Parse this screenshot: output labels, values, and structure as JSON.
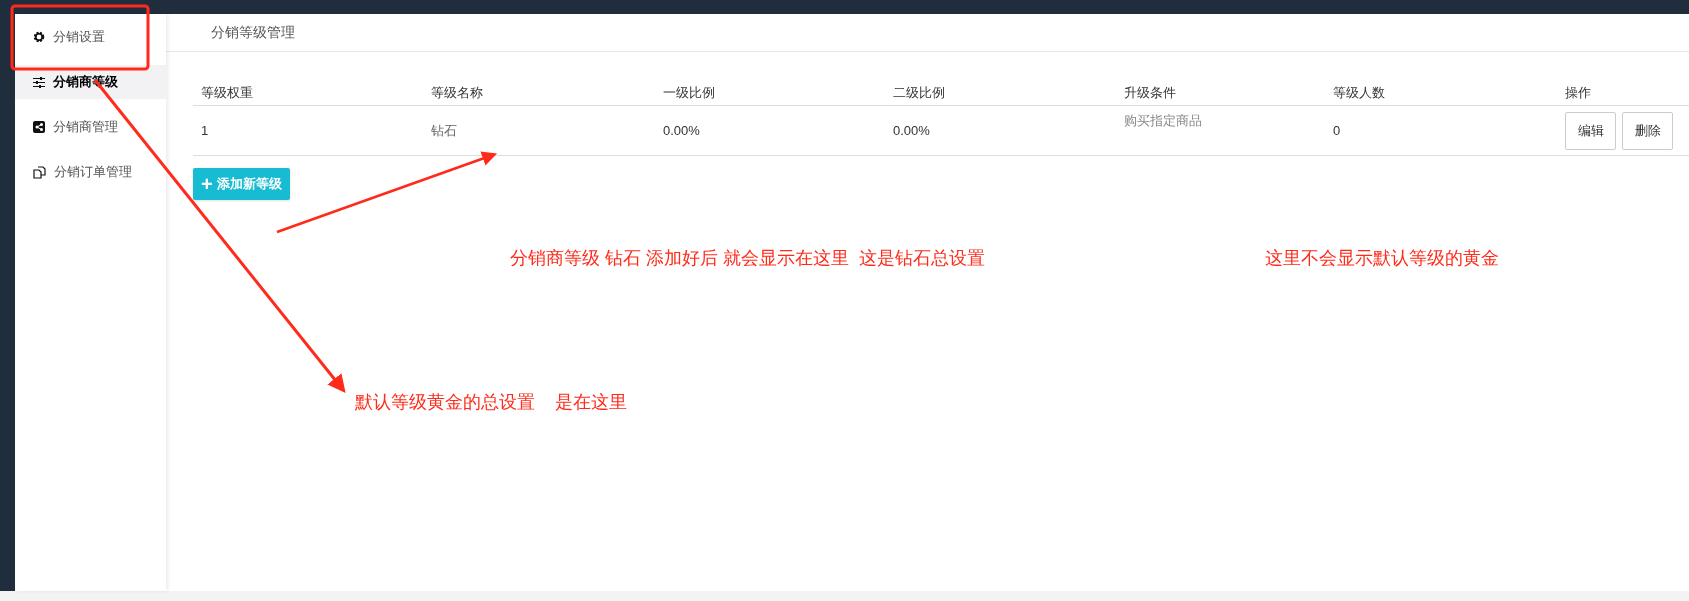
{
  "sidebar": {
    "items": [
      {
        "label": "分销设置",
        "selected": false
      },
      {
        "label": "分销商等级",
        "selected": true
      },
      {
        "label": "分销商管理",
        "selected": false
      },
      {
        "label": "分销订单管理",
        "selected": false
      }
    ]
  },
  "page_title": "分销等级管理",
  "table": {
    "columns": [
      "等级权重",
      "等级名称",
      "一级比例",
      "二级比例",
      "升级条件",
      "等级人数",
      "操作"
    ],
    "rows": [
      {
        "cells": [
          "1",
          "钻石",
          "0.00%",
          "0.00%",
          "购买指定商品",
          "0"
        ],
        "actions": [
          "编辑",
          "删除"
        ]
      }
    ]
  },
  "add_button": {
    "icon": "+",
    "label": "添加新等级"
  },
  "annotations": [
    {
      "text": "分销商等级 钻石 添加好后 就会显示在这里  这是钻石总设置"
    },
    {
      "text": "这里不会显示默认等级的黄金"
    },
    {
      "text": "默认等级黄金的总设置    是在这里"
    }
  ]
}
